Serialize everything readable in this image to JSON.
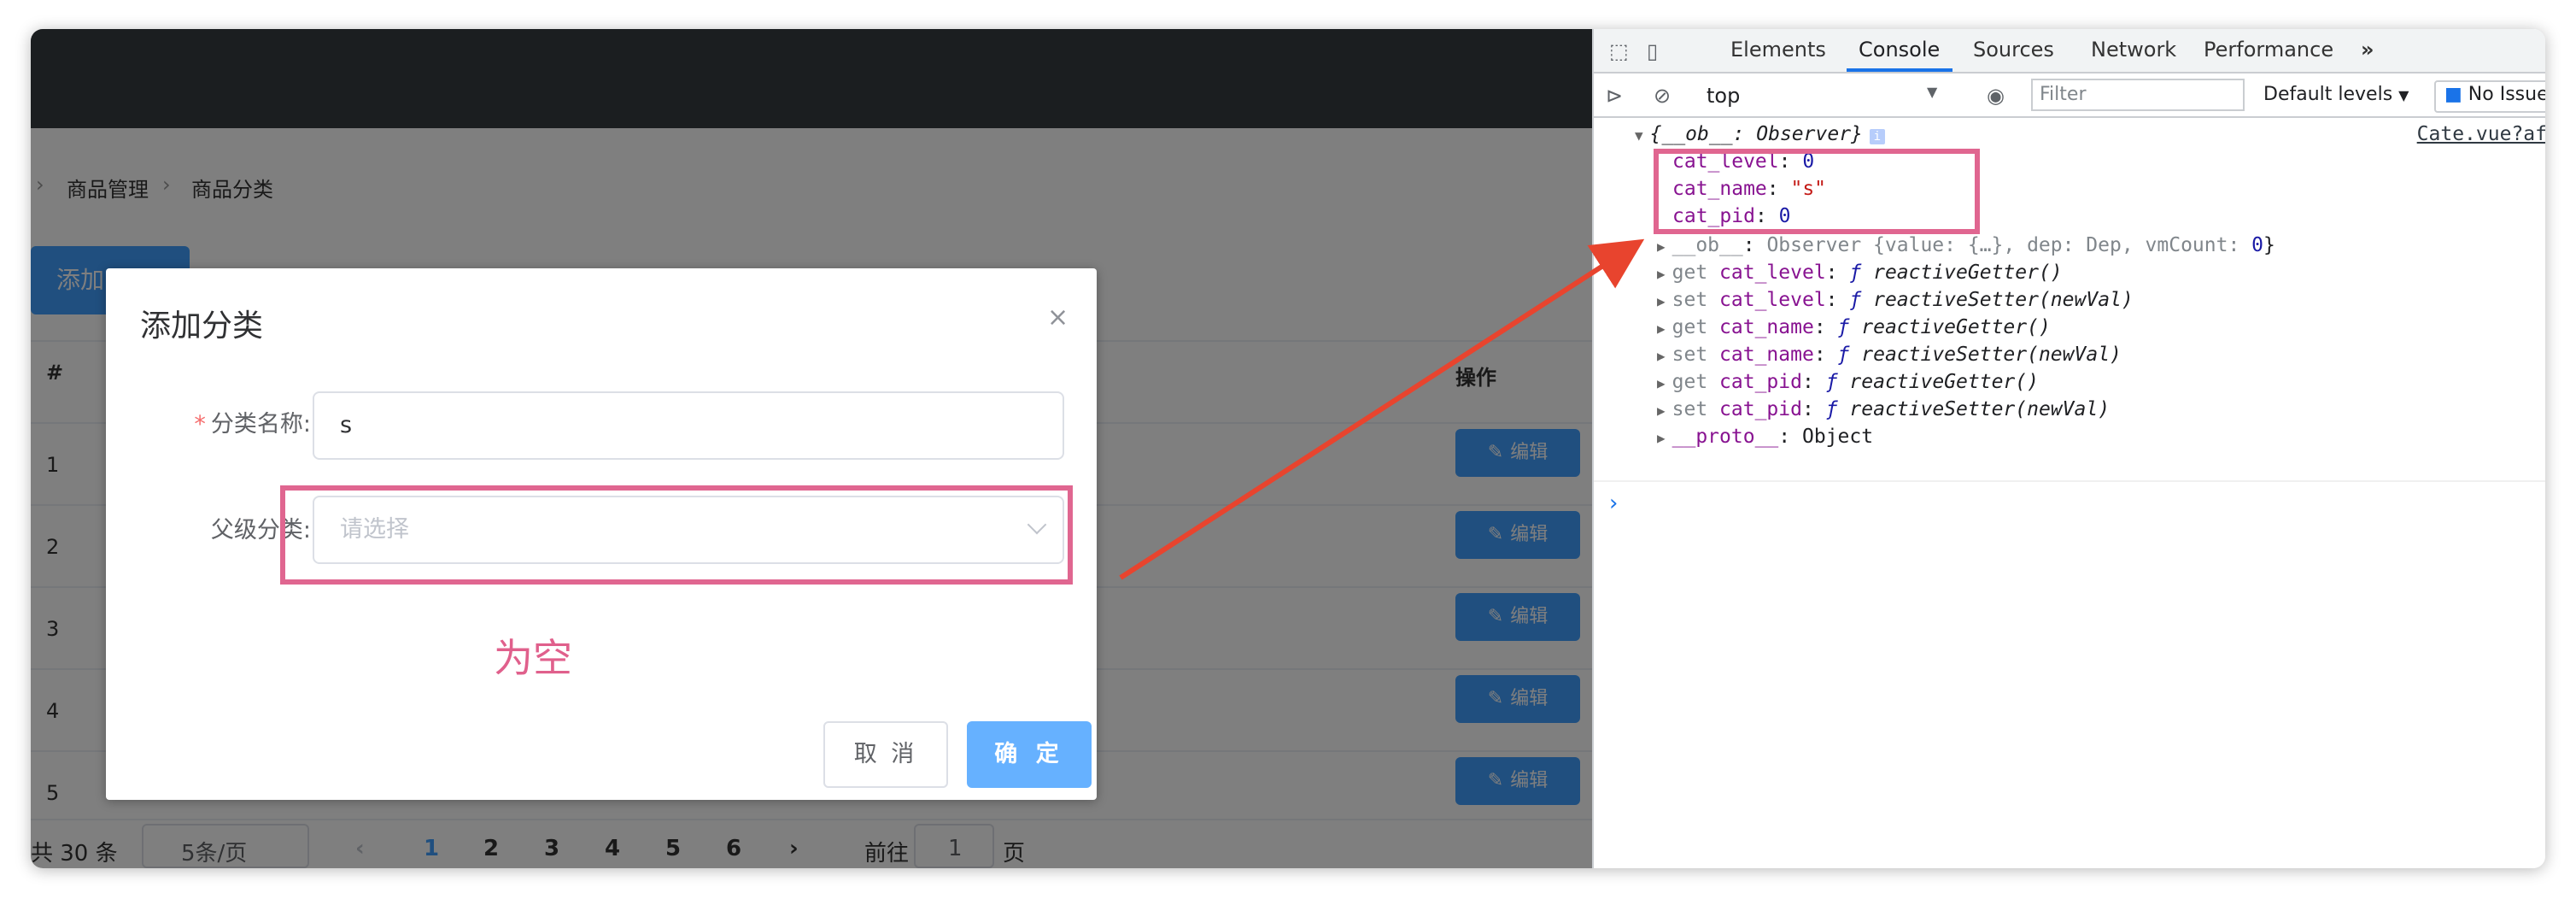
{
  "breadcrumb": {
    "items": [
      "商品管理",
      "商品分类"
    ]
  },
  "toolbar": {
    "add_label": "添加"
  },
  "table": {
    "headers": {
      "index": "#",
      "actions": "操作"
    },
    "rows": [
      {
        "index": "1",
        "action": "编辑"
      },
      {
        "index": "2",
        "action": "编辑"
      },
      {
        "index": "3",
        "action": "编辑"
      },
      {
        "index": "4",
        "action": "编辑"
      },
      {
        "index": "5",
        "action": "编辑"
      }
    ]
  },
  "pagination": {
    "total": "共 30 条",
    "page_size": "5条/页",
    "prev": "‹",
    "pages": [
      "1",
      "2",
      "3",
      "4",
      "5",
      "6"
    ],
    "next": "›",
    "goto_label": "前往",
    "goto_value": "1",
    "goto_suffix": "页"
  },
  "dialog": {
    "title": "添加分类",
    "close": "×",
    "name_label": "分类名称:",
    "name_required": "*",
    "name_value": "s",
    "parent_label": "父级分类:",
    "parent_placeholder": "请选择",
    "annotation": "为空",
    "cancel_label": "取 消",
    "confirm_label": "确 定"
  },
  "devtools": {
    "tabs": [
      "Elements",
      "Console",
      "Sources",
      "Network",
      "Performance",
      "»"
    ],
    "context": "top",
    "filter_placeholder": "Filter",
    "levels": "Default levels",
    "issues": "No Issues",
    "source_link": "Cate.vue?af",
    "console": {
      "object_head": "{__ob__: Observer}",
      "props": [
        {
          "key": "cat_level",
          "value": "0",
          "type": "number"
        },
        {
          "key": "cat_name",
          "value": "\"s\"",
          "type": "string"
        },
        {
          "key": "cat_pid",
          "value": "0",
          "type": "number"
        }
      ],
      "ob_key": "__ob__",
      "ob_value": "Observer {value: {…}, dep: Dep, vmCount: ",
      "ob_count": "0",
      "ob_close": "}",
      "accessors": [
        {
          "prefix": "get",
          "key": "cat_level",
          "fn": "reactiveGetter()"
        },
        {
          "prefix": "set",
          "key": "cat_level",
          "fn": "reactiveSetter(newVal)"
        },
        {
          "prefix": "get",
          "key": "cat_name",
          "fn": "reactiveGetter()"
        },
        {
          "prefix": "set",
          "key": "cat_name",
          "fn": "reactiveSetter(newVal)"
        },
        {
          "prefix": "get",
          "key": "cat_pid",
          "fn": "reactiveGetter()"
        },
        {
          "prefix": "set",
          "key": "cat_pid",
          "fn": "reactiveSetter(newVal)"
        }
      ],
      "proto_key": "__proto__",
      "proto_value": "Object",
      "fn_symbol": "ƒ",
      "prompt": "›"
    }
  },
  "annotation_color": "#e06690",
  "arrow_color": "#e8442e"
}
